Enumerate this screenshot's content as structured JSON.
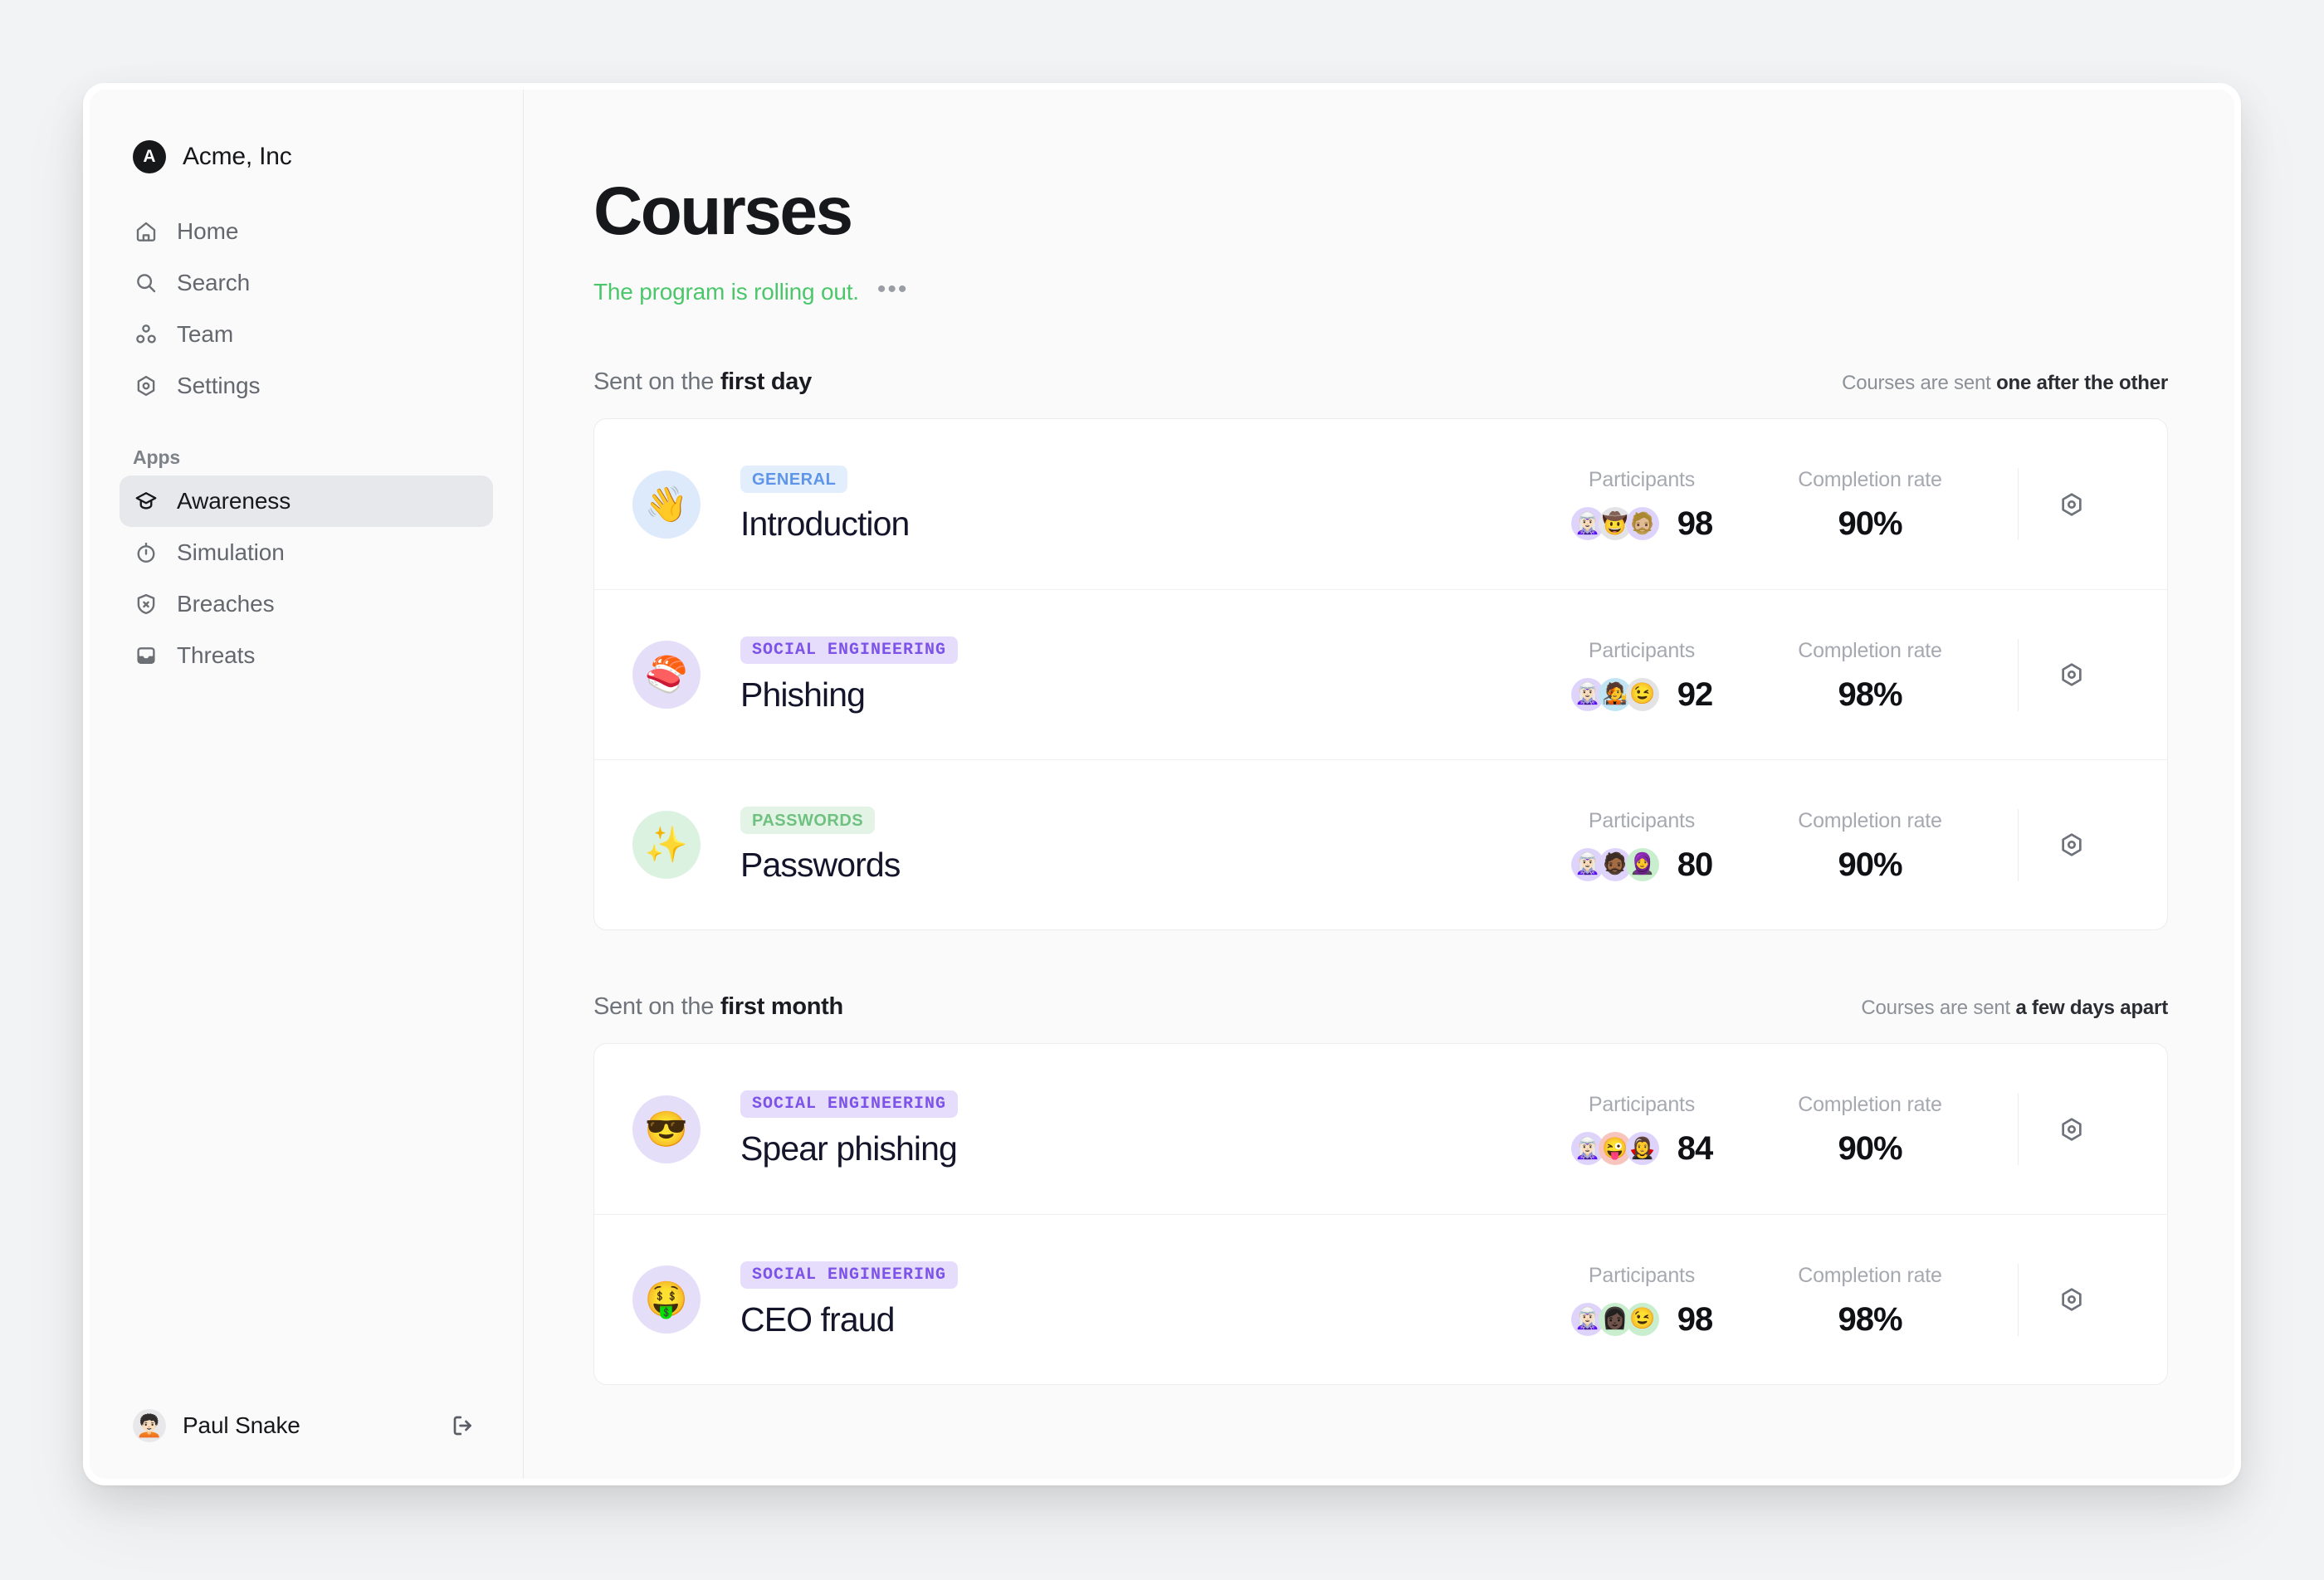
{
  "sidebar": {
    "brand": {
      "initial": "A",
      "name": "Acme, Inc"
    },
    "items": [
      {
        "label": "Home",
        "icon": "home-icon"
      },
      {
        "label": "Search",
        "icon": "search-icon"
      },
      {
        "label": "Team",
        "icon": "team-icon"
      },
      {
        "label": "Settings",
        "icon": "settings-icon"
      }
    ],
    "apps_label": "Apps",
    "apps": [
      {
        "label": "Awareness",
        "icon": "graduation-cap-icon",
        "active": true
      },
      {
        "label": "Simulation",
        "icon": "stopwatch-icon",
        "active": false
      },
      {
        "label": "Breaches",
        "icon": "shield-x-icon",
        "active": false
      },
      {
        "label": "Threats",
        "icon": "inbox-icon",
        "active": false
      }
    ],
    "footer": {
      "user_name": "Paul Snake",
      "user_avatar": "🧑🏻‍🦱",
      "logout_icon": "logout-icon"
    }
  },
  "header": {
    "title": "Courses",
    "subtitle": "The program is rolling out.",
    "subtitle_color": "#4cc66a",
    "more_label": "•••"
  },
  "sections": [
    {
      "label_prefix": "Sent on the ",
      "label_strong": "first day",
      "note_prefix": "Courses are sent ",
      "note_strong": "one after the other",
      "courses": [
        {
          "emoji": "👋",
          "emoji_bg": "#ddeafb",
          "category": "GENERAL",
          "category_bg": "#e3eefc",
          "category_color": "#5e95e8",
          "category_mono": false,
          "name": "Introduction",
          "participants_label": "Participants",
          "participants": "98",
          "avatars": [
            {
              "glyph": "🧝🏻‍♀️",
              "bg": "#ded4fb"
            },
            {
              "glyph": "🤠",
              "bg": "#e3e3e6"
            },
            {
              "glyph": "🧔🏼",
              "bg": "#ded4fb"
            }
          ],
          "completion_label": "Completion rate",
          "completion": "90%",
          "action_icon": "settings-icon"
        },
        {
          "emoji": "🍣",
          "emoji_bg": "#e5def9",
          "category": "SOCIAL ENGINEERING",
          "category_bg": "#e5ddfb",
          "category_color": "#7c52e8",
          "category_mono": true,
          "name": "Phishing",
          "participants_label": "Participants",
          "participants": "92",
          "avatars": [
            {
              "glyph": "🧝🏻‍♀️",
              "bg": "#ded4fb"
            },
            {
              "glyph": "🧑‍🎤",
              "bg": "#bfe5f5"
            },
            {
              "glyph": "😉",
              "bg": "#e3e3e6"
            }
          ],
          "completion_label": "Completion rate",
          "completion": "98%",
          "action_icon": "settings-icon"
        },
        {
          "emoji": "✨",
          "emoji_bg": "#dcf2e0",
          "category": "PASSWORDS",
          "category_bg": "#e3f4e6",
          "category_color": "#6fc17f",
          "category_mono": false,
          "name": "Passwords",
          "participants_label": "Participants",
          "participants": "80",
          "avatars": [
            {
              "glyph": "🧝🏻‍♀️",
              "bg": "#ded4fb"
            },
            {
              "glyph": "🧔🏾",
              "bg": "#ded4fb"
            },
            {
              "glyph": "🧕",
              "bg": "#c8eecd"
            }
          ],
          "completion_label": "Completion rate",
          "completion": "90%",
          "action_icon": "settings-icon"
        }
      ]
    },
    {
      "label_prefix": "Sent on the ",
      "label_strong": "first month",
      "note_prefix": "Courses are sent ",
      "note_strong": "a few days apart",
      "courses": [
        {
          "emoji": "😎",
          "emoji_bg": "#e5def9",
          "category": "SOCIAL ENGINEERING",
          "category_bg": "#e5ddfb",
          "category_color": "#7c52e8",
          "category_mono": true,
          "name": "Spear phishing",
          "participants_label": "Participants",
          "participants": "84",
          "avatars": [
            {
              "glyph": "🧝🏻‍♀️",
              "bg": "#ded4fb"
            },
            {
              "glyph": "😜",
              "bg": "#f7c5bd"
            },
            {
              "glyph": "🧛‍♀️",
              "bg": "#ded4fb"
            }
          ],
          "completion_label": "Completion rate",
          "completion": "90%",
          "action_icon": "settings-icon"
        },
        {
          "emoji": "🤑",
          "emoji_bg": "#e5def9",
          "category": "SOCIAL ENGINEERING",
          "category_bg": "#e5ddfb",
          "category_color": "#7c52e8",
          "category_mono": true,
          "name": "CEO fraud",
          "participants_label": "Participants",
          "participants": "98",
          "avatars": [
            {
              "glyph": "🧝🏻‍♀️",
              "bg": "#ded4fb"
            },
            {
              "glyph": "👩🏿",
              "bg": "#c8eecd"
            },
            {
              "glyph": "😉",
              "bg": "#c8eecd"
            }
          ],
          "completion_label": "Completion rate",
          "completion": "98%",
          "action_icon": "settings-icon"
        }
      ]
    }
  ]
}
